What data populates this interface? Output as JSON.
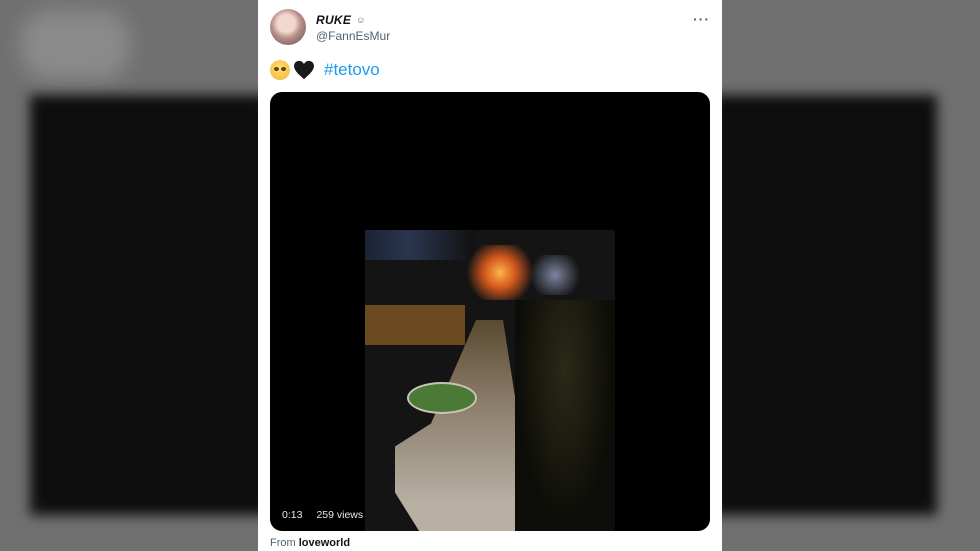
{
  "tweet": {
    "display_name": "RUKE",
    "name_emoji": "☺",
    "handle": "@FannEsMur",
    "more_icon": "more-horizontal-icon",
    "hashtag": "#tetovo",
    "emojis": [
      "face-emoji",
      "black-heart-emoji"
    ]
  },
  "video": {
    "duration": "0:13",
    "views": "259 views"
  },
  "source": {
    "prefix": "From",
    "name": "loveworld"
  }
}
